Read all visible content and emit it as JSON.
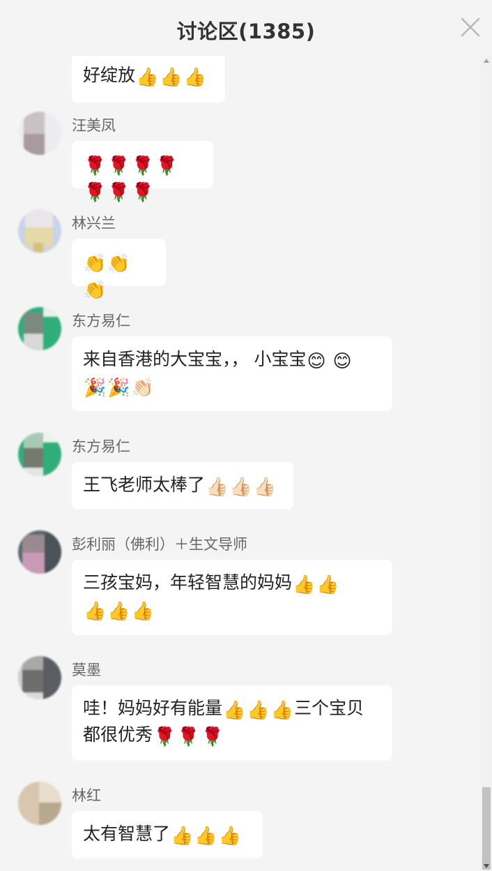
{
  "header": {
    "title": "讨论区(1385)",
    "close_icon": "close-icon"
  },
  "comments": [
    {
      "name": "",
      "text": "好绽放",
      "emojis": [
        "👍",
        "👍",
        "👍"
      ],
      "avatar_colors": [
        "#222222",
        "#ffffff"
      ]
    },
    {
      "name": "汪美凤",
      "text": "",
      "emojis": [
        "🌹",
        "🌹",
        "🌹",
        "🌹",
        "🌹",
        "🌹",
        "🌹"
      ],
      "avatar_colors": [
        "#c9c1c4",
        "#a89a9e",
        "#efedf0",
        "#dcd6da"
      ]
    },
    {
      "name": "林兴兰",
      "text": "",
      "emojis": [
        "👏",
        "👏",
        "👏"
      ],
      "avatar_colors": [
        "#e8e6e8",
        "#d9d0a8",
        "#c8d4e8",
        "#f4f0e0"
      ]
    },
    {
      "name": "东方易仁",
      "text": "来自香港的大宝宝，，  小宝宝",
      "emojis": [
        "😊",
        "😊",
        "🎉",
        "🎉",
        "👏🏻"
      ],
      "avatar_colors": [
        "#8aa992",
        "#2fae7a",
        "#7c8a7e",
        "#d8d8d8"
      ]
    },
    {
      "name": "东方易仁",
      "text": "王飞老师太棒了",
      "emojis": [
        "👍🏻",
        "👍🏻",
        "👍🏻"
      ],
      "avatar_colors": [
        "#a9c9b6",
        "#2fae7a",
        "#757a70",
        "#e4e4e4"
      ]
    },
    {
      "name": "彭利丽（佛利）＋生文导师",
      "text": "三孩宝妈，年轻智慧的妈妈",
      "emojis": [
        "👍",
        "👍",
        "👍",
        "👍",
        "👍"
      ],
      "avatar_colors": [
        "#9a8a90",
        "#5a6a6e",
        "#c99ab7",
        "#d4c8cc"
      ]
    },
    {
      "name": "莫墨",
      "text": "哇！妈妈好有能量",
      "text2": "三个宝贝都很优秀",
      "emojis": [
        "👍",
        "👍",
        "👍"
      ],
      "emojis2": [
        "🌹",
        "🌹",
        "🌹"
      ],
      "avatar_colors": [
        "#a8a8a8",
        "#5a5e63",
        "#6d6d6d",
        "#dadada"
      ]
    },
    {
      "name": "林红",
      "text": "太有智慧了",
      "emojis": [
        "👍",
        "👍",
        "👍"
      ],
      "avatar_colors": [
        "#d9c6b0",
        "#c0a88e",
        "#e8dccc",
        "#b8a890"
      ]
    }
  ],
  "scrollbar": {
    "position": 0.95
  }
}
